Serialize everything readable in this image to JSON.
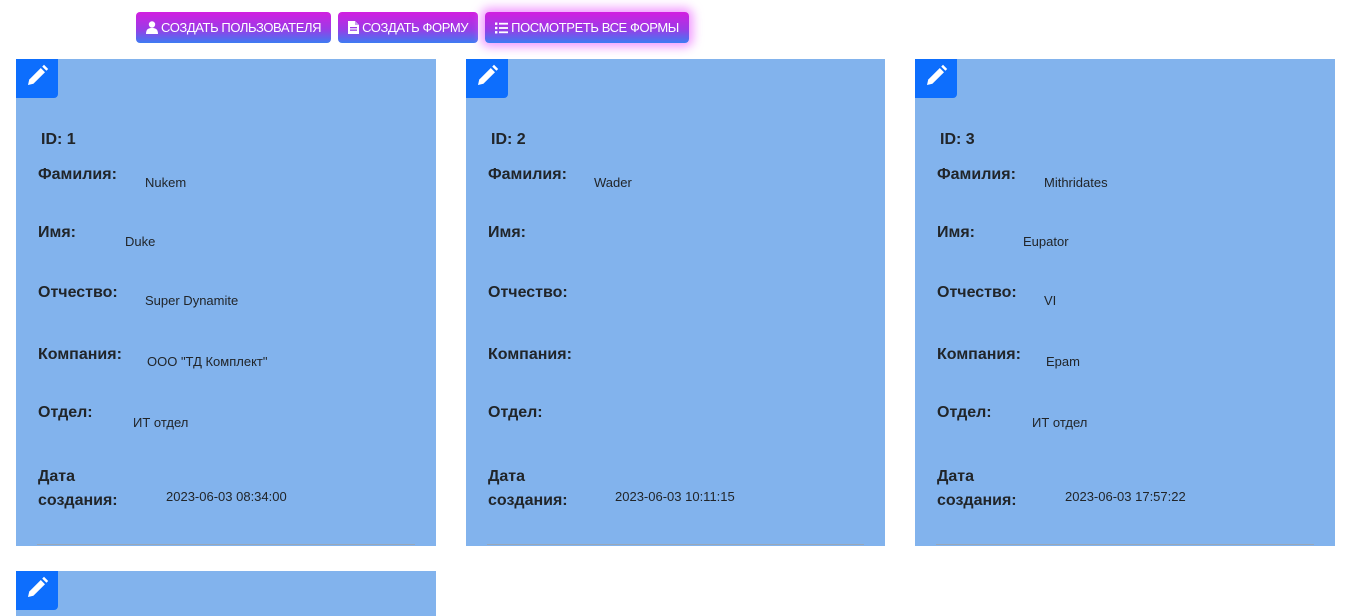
{
  "toolbar": {
    "create_user": "СОЗДАТЬ ПОЛЬЗОВАТЕЛЯ",
    "create_form": "СОЗДАТЬ ФОРМУ",
    "view_forms": "ПОСМОТРЕТЬ ВСЕ ФОРМЫ"
  },
  "labels": {
    "surname": "Фамилия:",
    "name": "Имя:",
    "patronymic": "Отчество:",
    "company": "Компания:",
    "department": "Отдел:",
    "created_1": "Дата",
    "created_2": "создания:"
  },
  "cards": [
    {
      "id": "ID: 1",
      "surname": "Nukem",
      "name": "Duke",
      "patronymic": "Super Dynamite",
      "company": "ООО \"ТД Комплект\"",
      "department": "ИТ отдел",
      "created": "2023-06-03 08:34:00"
    },
    {
      "id": "ID: 2",
      "surname": "Wader",
      "name": "",
      "patronymic": "",
      "company": "",
      "department": "",
      "created": "2023-06-03 10:11:15"
    },
    {
      "id": "ID: 3",
      "surname": "Mithridates",
      "name": "Eupator",
      "patronymic": "VI",
      "company": "Epam",
      "department": "ИТ отдел",
      "created": "2023-06-03 17:57:22"
    }
  ],
  "colors": {
    "card": "#82b3ed",
    "edit_button": "#0d6efd",
    "button_gradient": [
      "#d21fe0",
      "#3d7cf2"
    ]
  },
  "icons": {
    "create_user": "user-icon",
    "create_form": "file-icon",
    "view_forms": "list-icon",
    "edit": "pencil-icon"
  }
}
